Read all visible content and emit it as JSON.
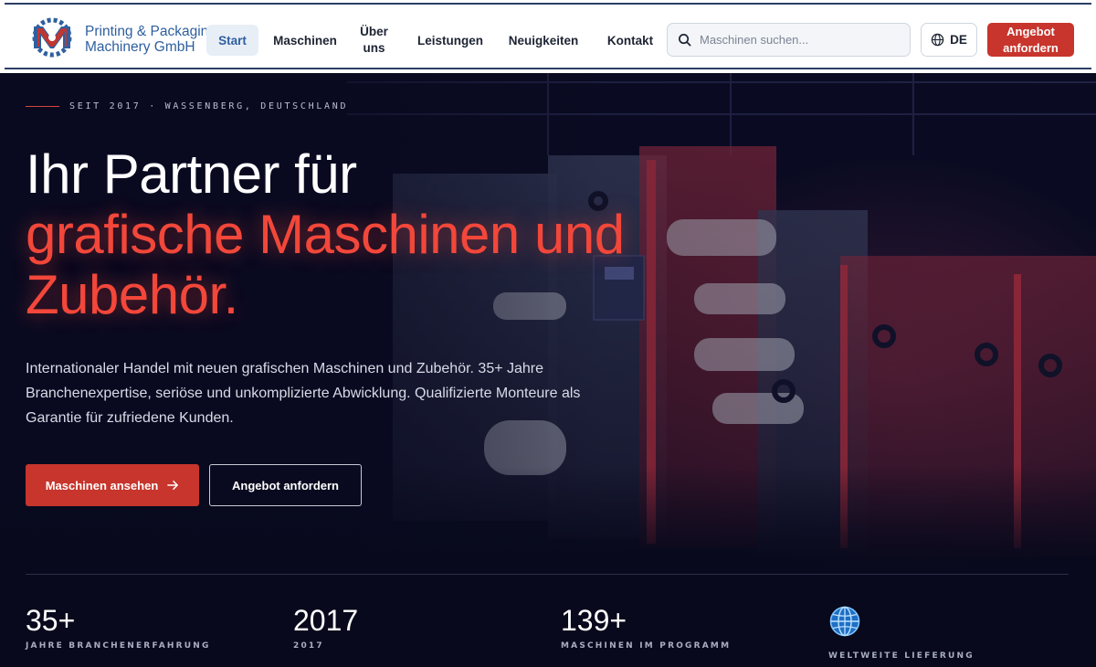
{
  "header": {
    "brand_line1": "Printing & Packaging",
    "brand_line2": "Machinery GmbH",
    "nav": {
      "start": "Start",
      "maschinen": "Maschinen",
      "ueber_line1": "Über",
      "ueber_line2": "uns",
      "leistungen": "Leistungen",
      "neuigkeiten": "Neuigkeiten",
      "kontakt": "Kontakt"
    },
    "search_placeholder": "Maschinen suchen...",
    "language": "DE",
    "cta_line1": "Angebot",
    "cta_line2": "anfordern"
  },
  "hero": {
    "eyebrow": "SEIT 2017 · WASSENBERG, DEUTSCHLAND",
    "title_line1": "Ihr Partner für",
    "title_line2": "grafische Maschinen und",
    "title_line3": "Zubehör.",
    "lead": "Internationaler Handel mit neuen grafischen Maschinen und Zubehör. 35+ Jahre Branchenexpertise, seriöse und unkomplizierte Abwicklung. Qualifizierte Monteure als Garantie für zufriedene Kunden.",
    "primary_button": "Maschinen ansehen",
    "secondary_button": "Angebot anfordern"
  },
  "stats": [
    {
      "value": "35+",
      "label": "JAHRE BRANCHENERFAHRUNG"
    },
    {
      "value": "2017",
      "label": "2017"
    },
    {
      "value": "139+",
      "label": "MASCHINEN IM PROGRAMM"
    },
    {
      "icon": "globe-icon",
      "label": "WELTWEITE LIEFERUNG"
    }
  ],
  "colors": {
    "accent": "#c7352c",
    "accent_glow": "#f2473a",
    "brand_blue": "#2f5f9f",
    "hero_bg": "#0b0c24"
  }
}
